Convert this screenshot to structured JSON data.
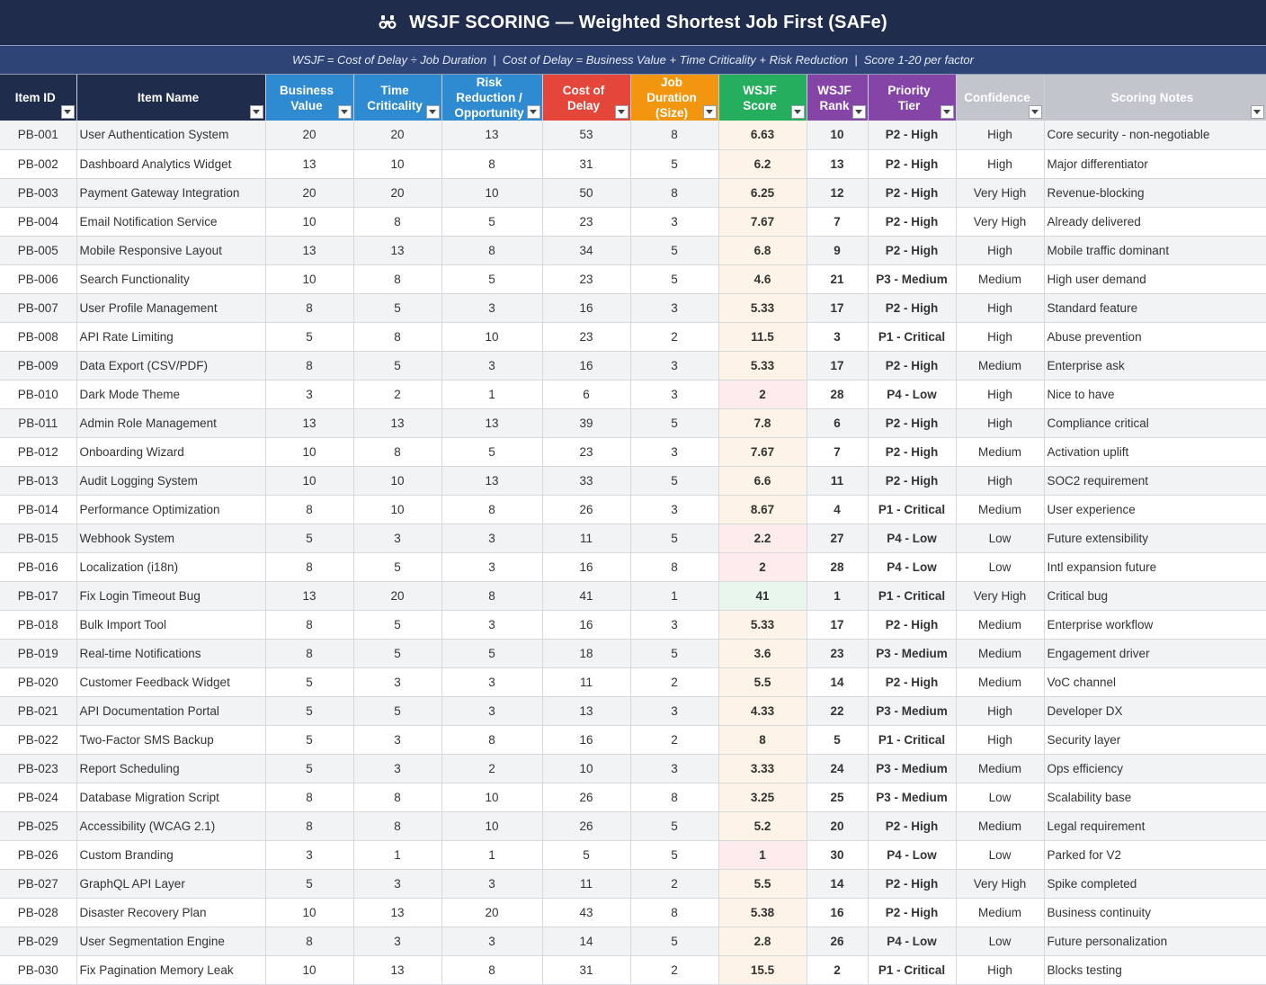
{
  "header": {
    "title": "WSJF SCORING — Weighted Shortest Job First (SAFe)",
    "title_icon": "binoculars-icon",
    "subtitle": "WSJF = Cost of Delay ÷ Job Duration  |  Cost of Delay = Business Value + Time Criticality + Risk Reduction  |  Score 1-20 per factor"
  },
  "colors": {
    "title_bg": "#1f2c4c",
    "subtitle_bg": "#2e4476",
    "business_value": "#2f8bd1",
    "cost_of_delay": "#e5463a",
    "job_duration": "#f2960f",
    "wsjf_score": "#25ae5d",
    "wsjf_rank": "#8445a7",
    "confidence": "#c2c5cb"
  },
  "columns": [
    {
      "line1": "Item ID",
      "line2": ""
    },
    {
      "line1": "Item Name",
      "line2": ""
    },
    {
      "line1": "Business",
      "line2": "Value"
    },
    {
      "line1": "Time",
      "line2": "Criticality"
    },
    {
      "line1": "Risk Reduction /",
      "line2": "Opportunity"
    },
    {
      "line1": "Cost of",
      "line2": "Delay"
    },
    {
      "line1": "Job Duration",
      "line2": "(Size)"
    },
    {
      "line1": "WSJF",
      "line2": "Score"
    },
    {
      "line1": "WSJF",
      "line2": "Rank"
    },
    {
      "line1": "Priority",
      "line2": "Tier"
    },
    {
      "line1": "Confidence",
      "line2": ""
    },
    {
      "line1": "Scoring Notes",
      "line2": ""
    }
  ],
  "rows": [
    {
      "id": "PB-001",
      "name": "User Authentication System",
      "bv": "20",
      "tc": "20",
      "rr": "13",
      "cod": "53",
      "size": "8",
      "wsjf": "6.63",
      "rank": "10",
      "tier": "P2 - High",
      "conf": "High",
      "notes": "Core security - non-negotiable"
    },
    {
      "id": "PB-002",
      "name": "Dashboard Analytics Widget",
      "bv": "13",
      "tc": "10",
      "rr": "8",
      "cod": "31",
      "size": "5",
      "wsjf": "6.2",
      "rank": "13",
      "tier": "P2 - High",
      "conf": "High",
      "notes": "Major differentiator"
    },
    {
      "id": "PB-003",
      "name": "Payment Gateway Integration",
      "bv": "20",
      "tc": "20",
      "rr": "10",
      "cod": "50",
      "size": "8",
      "wsjf": "6.25",
      "rank": "12",
      "tier": "P2 - High",
      "conf": "Very High",
      "notes": "Revenue-blocking"
    },
    {
      "id": "PB-004",
      "name": "Email Notification Service",
      "bv": "10",
      "tc": "8",
      "rr": "5",
      "cod": "23",
      "size": "3",
      "wsjf": "7.67",
      "rank": "7",
      "tier": "P2 - High",
      "conf": "Very High",
      "notes": "Already delivered"
    },
    {
      "id": "PB-005",
      "name": "Mobile Responsive Layout",
      "bv": "13",
      "tc": "13",
      "rr": "8",
      "cod": "34",
      "size": "5",
      "wsjf": "6.8",
      "rank": "9",
      "tier": "P2 - High",
      "conf": "High",
      "notes": "Mobile traffic dominant"
    },
    {
      "id": "PB-006",
      "name": "Search Functionality",
      "bv": "10",
      "tc": "8",
      "rr": "5",
      "cod": "23",
      "size": "5",
      "wsjf": "4.6",
      "rank": "21",
      "tier": "P3 - Medium",
      "conf": "Medium",
      "notes": "High user demand"
    },
    {
      "id": "PB-007",
      "name": "User Profile Management",
      "bv": "8",
      "tc": "5",
      "rr": "3",
      "cod": "16",
      "size": "3",
      "wsjf": "5.33",
      "rank": "17",
      "tier": "P2 - High",
      "conf": "High",
      "notes": "Standard feature"
    },
    {
      "id": "PB-008",
      "name": "API Rate Limiting",
      "bv": "5",
      "tc": "8",
      "rr": "10",
      "cod": "23",
      "size": "2",
      "wsjf": "11.5",
      "rank": "3",
      "tier": "P1 - Critical",
      "conf": "High",
      "notes": "Abuse prevention"
    },
    {
      "id": "PB-009",
      "name": "Data Export (CSV/PDF)",
      "bv": "8",
      "tc": "5",
      "rr": "3",
      "cod": "16",
      "size": "3",
      "wsjf": "5.33",
      "rank": "17",
      "tier": "P2 - High",
      "conf": "Medium",
      "notes": "Enterprise ask"
    },
    {
      "id": "PB-010",
      "name": "Dark Mode Theme",
      "bv": "3",
      "tc": "2",
      "rr": "1",
      "cod": "6",
      "size": "3",
      "wsjf": "2",
      "rank": "28",
      "tier": "P4 - Low",
      "conf": "High",
      "notes": "Nice to have"
    },
    {
      "id": "PB-011",
      "name": "Admin Role Management",
      "bv": "13",
      "tc": "13",
      "rr": "13",
      "cod": "39",
      "size": "5",
      "wsjf": "7.8",
      "rank": "6",
      "tier": "P2 - High",
      "conf": "High",
      "notes": "Compliance critical"
    },
    {
      "id": "PB-012",
      "name": "Onboarding Wizard",
      "bv": "10",
      "tc": "8",
      "rr": "5",
      "cod": "23",
      "size": "3",
      "wsjf": "7.67",
      "rank": "7",
      "tier": "P2 - High",
      "conf": "Medium",
      "notes": "Activation uplift"
    },
    {
      "id": "PB-013",
      "name": "Audit Logging System",
      "bv": "10",
      "tc": "10",
      "rr": "13",
      "cod": "33",
      "size": "5",
      "wsjf": "6.6",
      "rank": "11",
      "tier": "P2 - High",
      "conf": "High",
      "notes": "SOC2 requirement"
    },
    {
      "id": "PB-014",
      "name": "Performance Optimization",
      "bv": "8",
      "tc": "10",
      "rr": "8",
      "cod": "26",
      "size": "3",
      "wsjf": "8.67",
      "rank": "4",
      "tier": "P1 - Critical",
      "conf": "Medium",
      "notes": "User experience"
    },
    {
      "id": "PB-015",
      "name": "Webhook System",
      "bv": "5",
      "tc": "3",
      "rr": "3",
      "cod": "11",
      "size": "5",
      "wsjf": "2.2",
      "rank": "27",
      "tier": "P4 - Low",
      "conf": "Low",
      "notes": "Future extensibility"
    },
    {
      "id": "PB-016",
      "name": "Localization (i18n)",
      "bv": "8",
      "tc": "5",
      "rr": "3",
      "cod": "16",
      "size": "8",
      "wsjf": "2",
      "rank": "28",
      "tier": "P4 - Low",
      "conf": "Low",
      "notes": "Intl expansion future"
    },
    {
      "id": "PB-017",
      "name": "Fix Login Timeout Bug",
      "bv": "13",
      "tc": "20",
      "rr": "8",
      "cod": "41",
      "size": "1",
      "wsjf": "41",
      "rank": "1",
      "tier": "P1 - Critical",
      "conf": "Very High",
      "notes": "Critical bug"
    },
    {
      "id": "PB-018",
      "name": "Bulk Import Tool",
      "bv": "8",
      "tc": "5",
      "rr": "3",
      "cod": "16",
      "size": "3",
      "wsjf": "5.33",
      "rank": "17",
      "tier": "P2 - High",
      "conf": "Medium",
      "notes": "Enterprise workflow"
    },
    {
      "id": "PB-019",
      "name": "Real-time Notifications",
      "bv": "8",
      "tc": "5",
      "rr": "5",
      "cod": "18",
      "size": "5",
      "wsjf": "3.6",
      "rank": "23",
      "tier": "P3 - Medium",
      "conf": "Medium",
      "notes": "Engagement driver"
    },
    {
      "id": "PB-020",
      "name": "Customer Feedback Widget",
      "bv": "5",
      "tc": "3",
      "rr": "3",
      "cod": "11",
      "size": "2",
      "wsjf": "5.5",
      "rank": "14",
      "tier": "P2 - High",
      "conf": "Medium",
      "notes": "VoC channel"
    },
    {
      "id": "PB-021",
      "name": "API Documentation Portal",
      "bv": "5",
      "tc": "5",
      "rr": "3",
      "cod": "13",
      "size": "3",
      "wsjf": "4.33",
      "rank": "22",
      "tier": "P3 - Medium",
      "conf": "High",
      "notes": "Developer DX"
    },
    {
      "id": "PB-022",
      "name": "Two-Factor SMS Backup",
      "bv": "5",
      "tc": "3",
      "rr": "8",
      "cod": "16",
      "size": "2",
      "wsjf": "8",
      "rank": "5",
      "tier": "P1 - Critical",
      "conf": "High",
      "notes": "Security layer"
    },
    {
      "id": "PB-023",
      "name": "Report Scheduling",
      "bv": "5",
      "tc": "3",
      "rr": "2",
      "cod": "10",
      "size": "3",
      "wsjf": "3.33",
      "rank": "24",
      "tier": "P3 - Medium",
      "conf": "Medium",
      "notes": "Ops efficiency"
    },
    {
      "id": "PB-024",
      "name": "Database Migration Script",
      "bv": "8",
      "tc": "8",
      "rr": "10",
      "cod": "26",
      "size": "8",
      "wsjf": "3.25",
      "rank": "25",
      "tier": "P3 - Medium",
      "conf": "Low",
      "notes": "Scalability base"
    },
    {
      "id": "PB-025",
      "name": "Accessibility (WCAG 2.1)",
      "bv": "8",
      "tc": "8",
      "rr": "10",
      "cod": "26",
      "size": "5",
      "wsjf": "5.2",
      "rank": "20",
      "tier": "P2 - High",
      "conf": "Medium",
      "notes": "Legal requirement"
    },
    {
      "id": "PB-026",
      "name": "Custom Branding",
      "bv": "3",
      "tc": "1",
      "rr": "1",
      "cod": "5",
      "size": "5",
      "wsjf": "1",
      "rank": "30",
      "tier": "P4 - Low",
      "conf": "Low",
      "notes": "Parked for V2"
    },
    {
      "id": "PB-027",
      "name": "GraphQL API Layer",
      "bv": "5",
      "tc": "3",
      "rr": "3",
      "cod": "11",
      "size": "2",
      "wsjf": "5.5",
      "rank": "14",
      "tier": "P2 - High",
      "conf": "Very High",
      "notes": "Spike completed"
    },
    {
      "id": "PB-028",
      "name": "Disaster Recovery Plan",
      "bv": "10",
      "tc": "13",
      "rr": "20",
      "cod": "43",
      "size": "8",
      "wsjf": "5.38",
      "rank": "16",
      "tier": "P2 - High",
      "conf": "Medium",
      "notes": "Business continuity"
    },
    {
      "id": "PB-029",
      "name": "User Segmentation Engine",
      "bv": "8",
      "tc": "3",
      "rr": "3",
      "cod": "14",
      "size": "5",
      "wsjf": "2.8",
      "rank": "26",
      "tier": "P4 - Low",
      "conf": "Low",
      "notes": "Future personalization"
    },
    {
      "id": "PB-030",
      "name": "Fix Pagination Memory Leak",
      "bv": "10",
      "tc": "13",
      "rr": "8",
      "cod": "31",
      "size": "2",
      "wsjf": "15.5",
      "rank": "2",
      "tier": "P1 - Critical",
      "conf": "High",
      "notes": "Blocks testing"
    }
  ]
}
